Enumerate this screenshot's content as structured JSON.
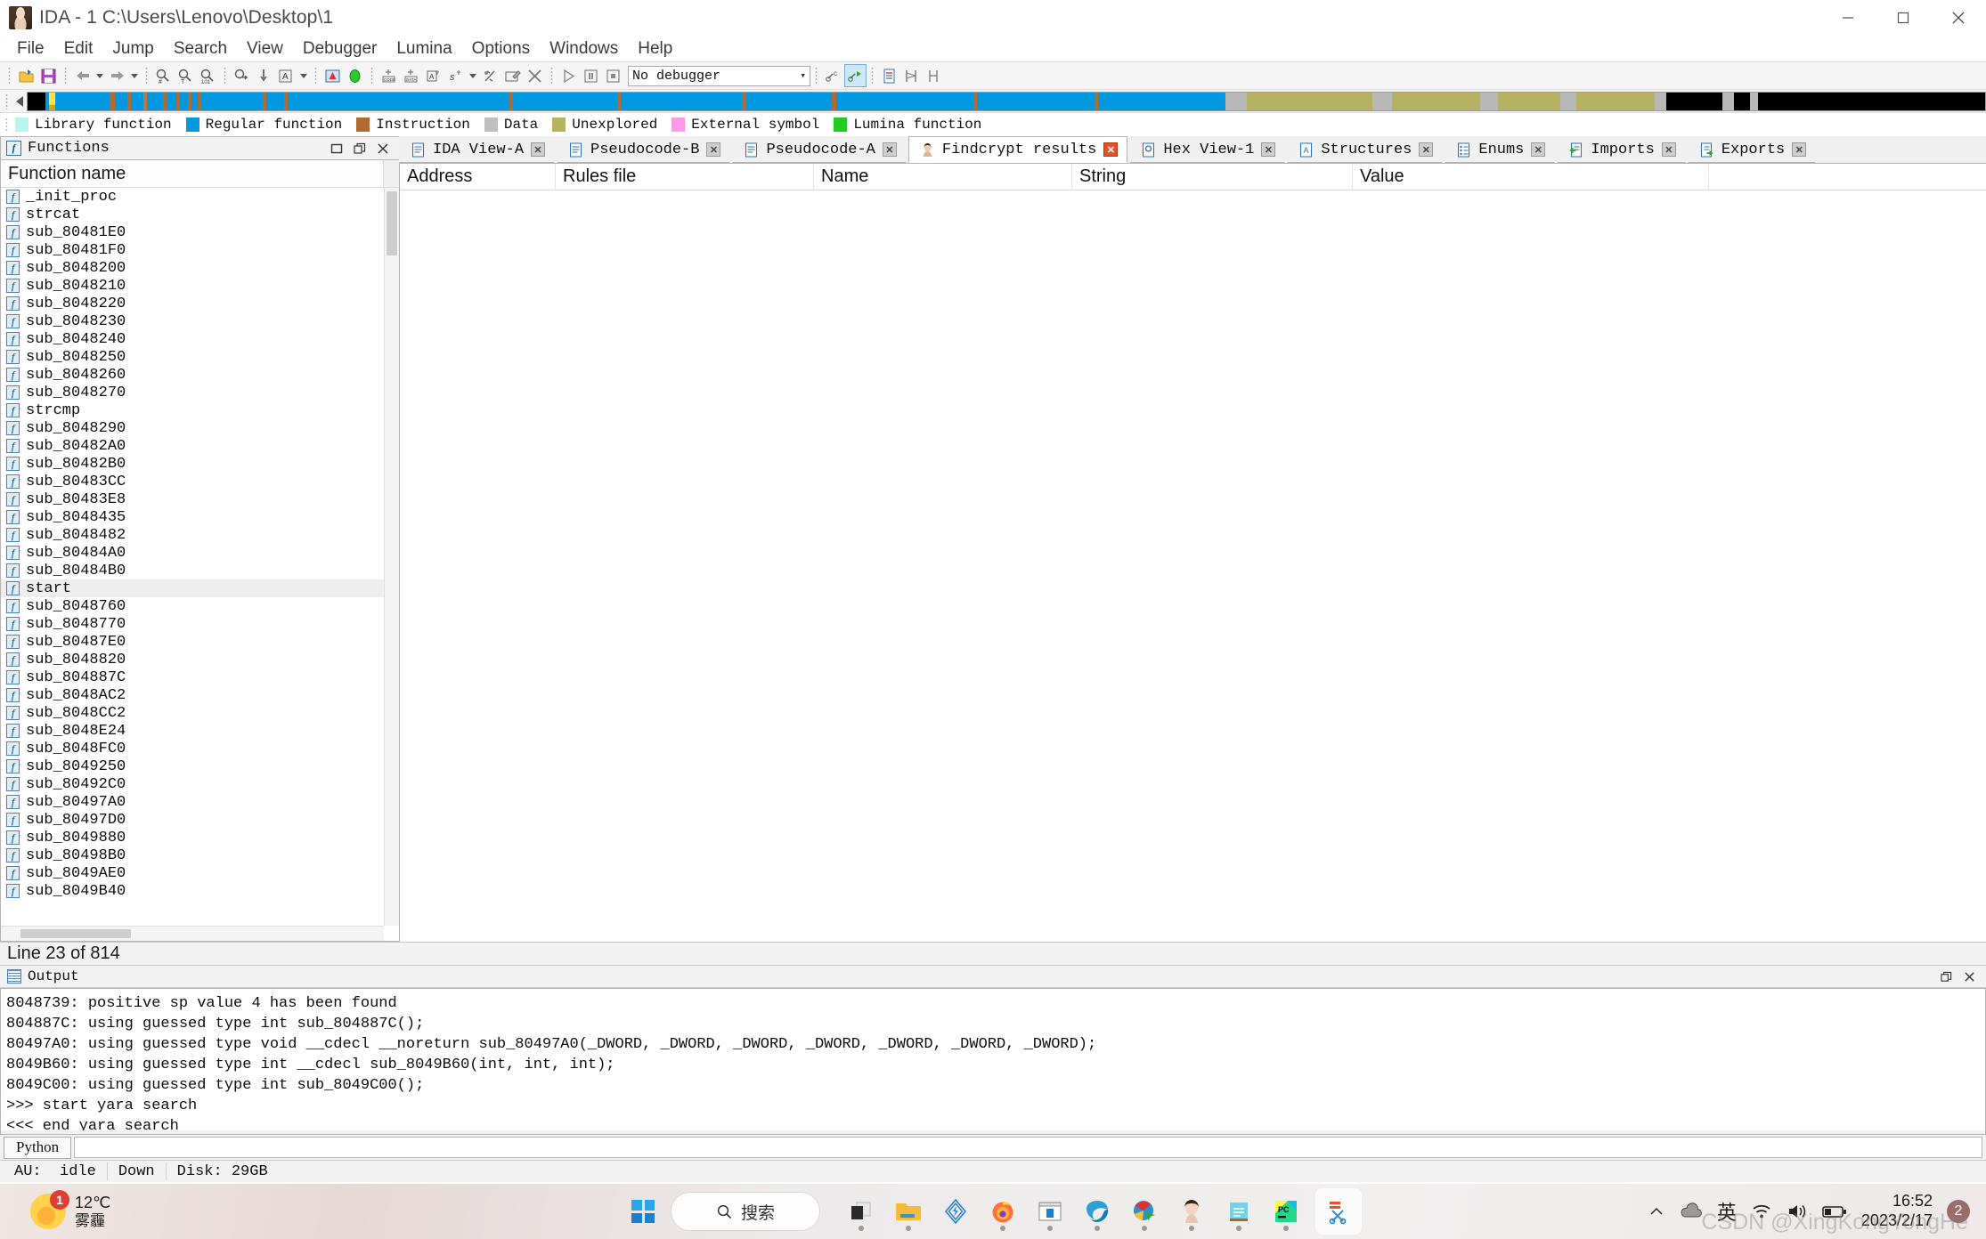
{
  "window": {
    "title": "IDA - 1 C:\\Users\\Lenovo\\Desktop\\1",
    "app_icon": "ida-woman-icon",
    "minimize": "minimize-button",
    "maximize": "maximize-button",
    "close": "close-button"
  },
  "menu": [
    {
      "label": "File"
    },
    {
      "label": "Edit"
    },
    {
      "label": "Jump"
    },
    {
      "label": "Search"
    },
    {
      "label": "View"
    },
    {
      "label": "Debugger"
    },
    {
      "label": "Lumina"
    },
    {
      "label": "Options"
    },
    {
      "label": "Windows"
    },
    {
      "label": "Help"
    }
  ],
  "toolbar": {
    "debugger_select": "No debugger",
    "chevron": "⌄",
    "buttons": [
      "open-file-icon",
      "save-icon",
      "back-arrow-icon",
      "forward-arrow-icon",
      "jump-to-address-icon",
      "jump-to-name-icon",
      "jump-to-number-icon",
      "jump-to-xref-icon",
      "jump-down-icon",
      "text-search-icon",
      "analysis-warning-icon",
      "green-status-icon",
      "make-code-icon",
      "make-data-icon",
      "make-array-icon",
      "make-string-icon",
      "undefine-icon",
      "edit-function-icon",
      "delete-icon",
      "run-icon",
      "pause-icon",
      "stop-icon",
      "step-icon",
      "attach-process-icon",
      "list-icon",
      "breakpoints-icon",
      "tracing-icon"
    ]
  },
  "navigator": {
    "cursor_position_pct": 1.1,
    "segments": [
      {
        "start": 0.0,
        "width": 100.0,
        "color": "#000000"
      },
      {
        "start": 0.9,
        "width": 60.3,
        "color": "#0099e0"
      },
      {
        "start": 4.2,
        "width": 0.25,
        "color": "#b06a32"
      },
      {
        "start": 5.1,
        "width": 0.2,
        "color": "#b06a32"
      },
      {
        "start": 5.9,
        "width": 0.2,
        "color": "#c07838"
      },
      {
        "start": 6.9,
        "width": 0.25,
        "color": "#b06a32"
      },
      {
        "start": 7.6,
        "width": 0.2,
        "color": "#b06a32"
      },
      {
        "start": 8.2,
        "width": 0.18,
        "color": "#b06a32"
      },
      {
        "start": 8.7,
        "width": 0.18,
        "color": "#b06a32"
      },
      {
        "start": 12.0,
        "width": 0.2,
        "color": "#b06a32"
      },
      {
        "start": 13.1,
        "width": 0.2,
        "color": "#b06a32"
      },
      {
        "start": 24.6,
        "width": 0.2,
        "color": "#b06a32"
      },
      {
        "start": 30.1,
        "width": 0.2,
        "color": "#b06a32"
      },
      {
        "start": 36.5,
        "width": 0.2,
        "color": "#b06a32"
      },
      {
        "start": 41.1,
        "width": 0.2,
        "color": "#b06a32"
      },
      {
        "start": 48.3,
        "width": 0.2,
        "color": "#b06a32"
      },
      {
        "start": 54.5,
        "width": 0.2,
        "color": "#b06a32"
      },
      {
        "start": 61.2,
        "width": 1.1,
        "color": "#b8b8b8"
      },
      {
        "start": 62.3,
        "width": 6.4,
        "color": "#b6b163"
      },
      {
        "start": 68.7,
        "width": 1.0,
        "color": "#b8b8b8"
      },
      {
        "start": 69.7,
        "width": 4.5,
        "color": "#b6b163"
      },
      {
        "start": 74.2,
        "width": 0.9,
        "color": "#b8b8b8"
      },
      {
        "start": 75.1,
        "width": 3.2,
        "color": "#b6b163"
      },
      {
        "start": 78.3,
        "width": 0.8,
        "color": "#b8b8b8"
      },
      {
        "start": 79.1,
        "width": 4.0,
        "color": "#b6b163"
      },
      {
        "start": 83.1,
        "width": 0.6,
        "color": "#b8b8b8"
      },
      {
        "start": 83.7,
        "width": 16.3,
        "color": "#000000"
      },
      {
        "start": 86.6,
        "width": 0.55,
        "color": "#b8b8b8"
      },
      {
        "start": 88.0,
        "width": 0.4,
        "color": "#b8b8b8"
      }
    ]
  },
  "legend": [
    {
      "label": "Library function",
      "color": "#b8f5f0"
    },
    {
      "label": "Regular function",
      "color": "#0099e0"
    },
    {
      "label": "Instruction",
      "color": "#b06a32"
    },
    {
      "label": "Data",
      "color": "#bfbfbf"
    },
    {
      "label": "Unexplored",
      "color": "#b6b163"
    },
    {
      "label": "External symbol",
      "color": "#ff9ae8"
    },
    {
      "label": "Lumina function",
      "color": "#22cc22"
    }
  ],
  "functions_panel": {
    "title": "Functions",
    "icon": "function-f-icon",
    "window_buttons": [
      "restore-button",
      "float-button",
      "close-button"
    ],
    "column_header": "Function name",
    "items": [
      "_init_proc",
      "strcat",
      "sub_80481E0",
      "sub_80481F0",
      "sub_8048200",
      "sub_8048210",
      "sub_8048220",
      "sub_8048230",
      "sub_8048240",
      "sub_8048250",
      "sub_8048260",
      "sub_8048270",
      "strcmp",
      "sub_8048290",
      "sub_80482A0",
      "sub_80482B0",
      "sub_80483CC",
      "sub_80483E8",
      "sub_8048435",
      "sub_8048482",
      "sub_80484A0",
      "sub_80484B0",
      "start",
      "sub_8048760",
      "sub_8048770",
      "sub_80487E0",
      "sub_8048820",
      "sub_804887C",
      "sub_8048AC2",
      "sub_8048CC2",
      "sub_8048E24",
      "sub_8048FC0",
      "sub_8049250",
      "sub_80492C0",
      "sub_80497A0",
      "sub_80497D0",
      "sub_8049880",
      "sub_80498B0",
      "sub_8049AE0",
      "sub_8049B40"
    ],
    "selected": "start",
    "status": "Line 23 of 814"
  },
  "tabs": [
    {
      "label": "IDA View-A",
      "icon": "ida-view-icon",
      "active": false,
      "close_red": false
    },
    {
      "label": "Pseudocode-B",
      "icon": "pseudocode-icon",
      "active": false,
      "close_red": false
    },
    {
      "label": "Pseudocode-A",
      "icon": "pseudocode-icon",
      "active": false,
      "close_red": false
    },
    {
      "label": "Findcrypt results",
      "icon": "findcrypt-icon",
      "active": true,
      "close_red": true
    },
    {
      "label": "Hex View-1",
      "icon": "hex-view-icon",
      "active": false,
      "close_red": false
    },
    {
      "label": "Structures",
      "icon": "structures-icon",
      "active": false,
      "close_red": false
    },
    {
      "label": "Enums",
      "icon": "enums-icon",
      "active": false,
      "close_red": false
    },
    {
      "label": "Imports",
      "icon": "imports-icon",
      "active": false,
      "close_red": false
    },
    {
      "label": "Exports",
      "icon": "exports-icon",
      "active": false,
      "close_red": false
    }
  ],
  "findcrypt_results": {
    "columns": [
      "Address",
      "Rules file",
      "Name",
      "String",
      "Value"
    ],
    "rows": []
  },
  "output_window": {
    "title": "Output",
    "icon": "output-log-icon",
    "window_buttons": [
      "float-button",
      "close-button"
    ],
    "lines": [
      "8048739: positive sp value 4 has been found",
      "804887C: using guessed type int sub_804887C();",
      "80497A0: using guessed type void __cdecl __noreturn sub_80497A0(_DWORD, _DWORD, _DWORD, _DWORD, _DWORD, _DWORD, _DWORD);",
      "8049B60: using guessed type int __cdecl sub_8049B60(int, int, int);",
      "8049C00: using guessed type int sub_8049C00();",
      ">>> start yara search",
      "<<< end yara search"
    ]
  },
  "python_bar": {
    "button_label": "Python",
    "input_value": "",
    "placeholder": ""
  },
  "statusbar": {
    "au": "AU:  idle",
    "direction": "Down",
    "disk": "Disk: 29GB"
  },
  "taskbar": {
    "weather": {
      "temp": "12℃",
      "desc": "雾霾",
      "badge": "1",
      "icon": "weather-haze-icon"
    },
    "start": "windows-start-icon",
    "search": {
      "label": "搜索",
      "icon": "search-icon"
    },
    "apps": [
      {
        "name": "task-view-icon"
      },
      {
        "name": "file-explorer-icon"
      },
      {
        "name": "tim-icon"
      },
      {
        "name": "firefox-icon"
      },
      {
        "name": "app-window-icon"
      },
      {
        "name": "edge-icon"
      },
      {
        "name": "idm-icon"
      },
      {
        "name": "ida-woman-icon"
      },
      {
        "name": "notepad-icon"
      },
      {
        "name": "pycharm-icon"
      },
      {
        "name": "snipping-tool-icon"
      }
    ],
    "tray": {
      "chevron": "chevron-up-icon",
      "cloud": "onedrive-icon",
      "ime": "英",
      "wifi": "wifi-icon",
      "volume": "volume-icon",
      "battery": "battery-icon",
      "badge": "2"
    },
    "clock": {
      "time": "16:52",
      "date": "2023/2/17"
    },
    "watermark": "CSDN @XingKongYongHe"
  }
}
